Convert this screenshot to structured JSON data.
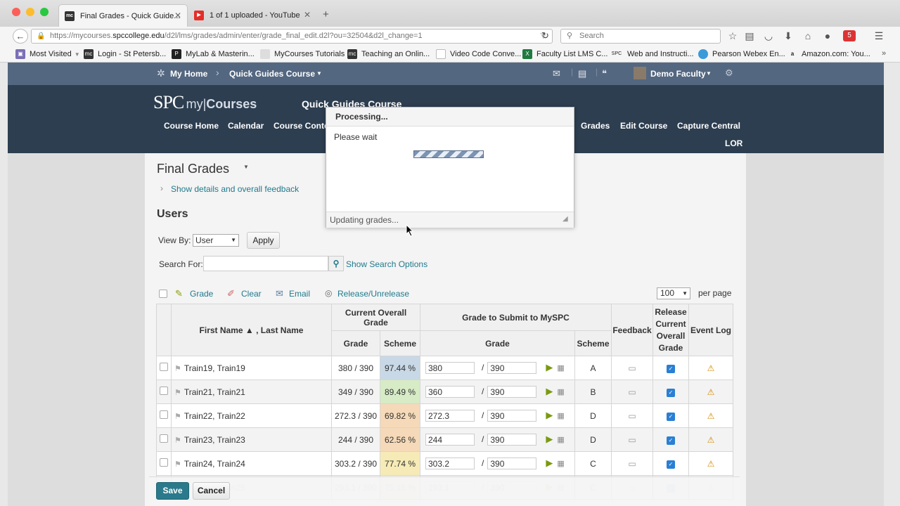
{
  "browser": {
    "tabs": [
      {
        "title": "Final Grades - Quick Guide...",
        "icon": "mc-favicon"
      },
      {
        "title": "1 of 1 uploaded - YouTube",
        "icon": "youtube-favicon"
      }
    ],
    "url_prefix": "https://mycourses.",
    "url_domain": "spccollege.edu",
    "url_path": "/d2l/lms/grades/admin/enter/grade_final_edit.d2l?ou=32504&d2l_change=1",
    "search_placeholder": "Search",
    "bookmarks": [
      "Most Visited",
      "Login - St Petersb...",
      "MyLab & Masterin...",
      "MyCourses Tutorials",
      "Teaching an Onlin...",
      "Video Code Conve...",
      "Faculty List LMS C...",
      "Web and Instructi...",
      "Pearson Webex En...",
      "Amazon.com: You..."
    ]
  },
  "minibar": {
    "home": "My Home",
    "course": "Quick Guides Course",
    "user": "Demo Faculty"
  },
  "header": {
    "logo_spc": "SPC",
    "logo_my": "my|",
    "logo_courses": "Courses",
    "course_title": "Quick Guides Course",
    "nav": [
      "Course Home",
      "Calendar",
      "Course Conte",
      "Grades",
      "Edit Course",
      "Capture Central",
      "LOR"
    ]
  },
  "content": {
    "title": "Final Grades",
    "show_details": "Show details and overall feedback",
    "users_heading": "Users",
    "view_by_label": "View By:",
    "view_by_value": "User",
    "apply": "Apply",
    "search_for_label": "Search For:",
    "search_value": "",
    "show_search_options": "Show Search Options",
    "actions": [
      "Grade",
      "Clear",
      "Email",
      "Release/Unrelease"
    ],
    "per_page_value": "100",
    "per_page_label": "per page"
  },
  "table": {
    "headers": {
      "name": "First Name ▲ , Last Name",
      "current_overall": "Current Overall Grade",
      "grade": "Grade",
      "scheme": "Scheme",
      "submit": "Grade to Submit to MySPC",
      "submit_grade": "Grade",
      "submit_scheme": "Scheme",
      "feedback": "Feedback",
      "release": "Release Current Overall Grade",
      "event_log": "Event Log"
    },
    "rows": [
      {
        "name": "Train19, Train19",
        "grade": "380 / 390",
        "scheme": "97.44 %",
        "submit": "380",
        "out_of": "390",
        "letter": "A",
        "scheme_color": "#c8d8e6"
      },
      {
        "name": "Train21, Train21",
        "grade": "349 / 390",
        "scheme": "89.49 %",
        "submit": "360",
        "out_of": "390",
        "letter": "B",
        "scheme_color": "#d6ebc6"
      },
      {
        "name": "Train22, Train22",
        "grade": "272.3 / 390",
        "scheme": "69.82 %",
        "submit": "272.3",
        "out_of": "390",
        "letter": "D",
        "scheme_color": "#f5d9b8"
      },
      {
        "name": "Train23, Train23",
        "grade": "244 / 390",
        "scheme": "62.56 %",
        "submit": "244",
        "out_of": "390",
        "letter": "D",
        "scheme_color": "#f5d9b8"
      },
      {
        "name": "Train24, Train24",
        "grade": "303.2 / 390",
        "scheme": "77.74 %",
        "submit": "303.2",
        "out_of": "390",
        "letter": "C",
        "scheme_color": "#f6ebb6"
      },
      {
        "name": "Train25, Train25",
        "grade": "293.1 / 390",
        "scheme": "75.15 %",
        "submit": "293.1",
        "out_of": "390",
        "letter": "C",
        "scheme_color": "#f6ebb6"
      }
    ]
  },
  "footer": {
    "save": "Save",
    "cancel": "Cancel"
  },
  "modal": {
    "title": "Processing...",
    "message": "Please wait",
    "status": "Updating grades..."
  },
  "colors": {
    "header_bg": "#2d3e50",
    "minibar_bg": "#546780",
    "save_button": "#2a7a8c"
  }
}
